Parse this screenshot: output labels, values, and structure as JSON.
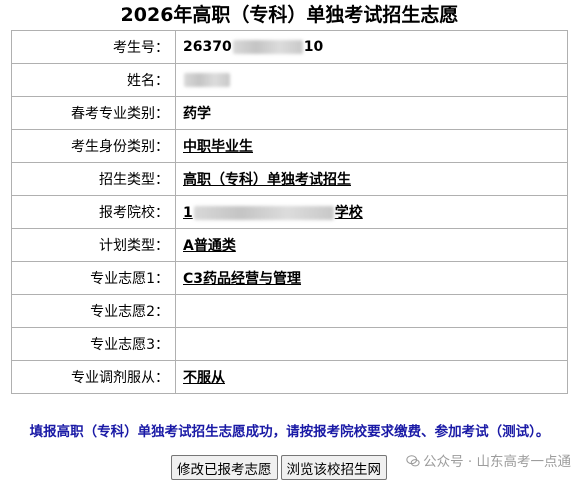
{
  "page": {
    "title": "2026年高职（专科）单独考试招生志愿"
  },
  "form": {
    "rows": [
      {
        "label": "考生号：",
        "value_head": "26370",
        "value_tail": "10"
      },
      {
        "label": "姓名：",
        "value": ""
      },
      {
        "label": "春考专业类别：",
        "value": "药学"
      },
      {
        "label": "考生身份类别：",
        "value": "中职毕业生"
      },
      {
        "label": "招生类型：",
        "value": "高职（专科）单独考试招生"
      },
      {
        "label": "报考院校：",
        "value_head": "1",
        "value_tail": "学校"
      },
      {
        "label": "计划类型：",
        "value": "A普通类"
      },
      {
        "label": "专业志愿1：",
        "value": "C3药品经营与管理"
      },
      {
        "label": "专业志愿2：",
        "value": ""
      },
      {
        "label": "专业志愿3：",
        "value": ""
      },
      {
        "label": "专业调剂服从：",
        "value": "不服从"
      }
    ]
  },
  "message": "填报高职（专科）单独考试招生志愿成功，请按报考院校要求缴费、参加考试（测试）。",
  "buttons": {
    "modify": "修改已报考志愿",
    "browse": "浏览该校招生网"
  },
  "watermark": {
    "text": "公众号 · 山东高考一点通",
    "icon": "wechat-icon"
  }
}
